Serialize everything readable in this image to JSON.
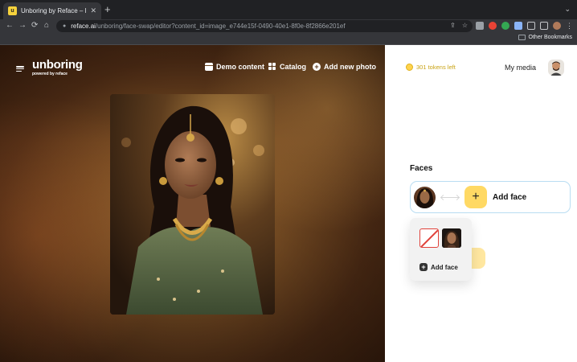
{
  "browser": {
    "tab_title": "Unboring by Reface – Face Sw",
    "tab_close": "✕",
    "new_tab": "+",
    "chevron": "⌄",
    "nav": {
      "back": "←",
      "forward": "→",
      "reload": "⟳",
      "home": "⌂"
    },
    "url_host": "reface.ai",
    "url_path": "/unboring/face-swap/editor?content_id=image_e744e15f-0490-40e1-8f0e-8f2866e201ef",
    "bookmarks_label": "Other Bookmarks",
    "colors": {
      "ext1": "#9aa0a6",
      "ext2": "#ea4335",
      "ext3": "#34a853",
      "ext4": "#8ab4f8"
    }
  },
  "app": {
    "logo": "unboring",
    "logo_sub": "powered by reface",
    "nav": {
      "demo": "Demo content",
      "catalog": "Catalog",
      "add_photo": "Add new photo",
      "add_icon": "+"
    },
    "panel": {
      "tokens": "301 tokens left",
      "my_media": "My media",
      "faces_title": "Faces",
      "add_face": "Add face",
      "add_face_icon": "+",
      "popup_add_face": "Add face",
      "popup_add_icon": "+"
    },
    "colors": {
      "accent_yellow": "#ffd964",
      "token_gold": "#c9a315",
      "face_row_border": "#b9ddf2",
      "none_red": "#e0423b"
    }
  }
}
